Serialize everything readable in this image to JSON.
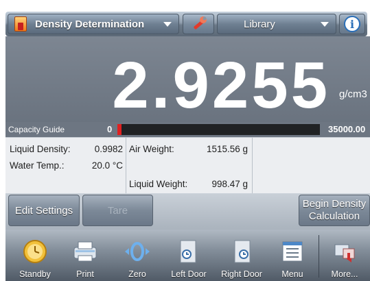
{
  "header": {
    "app_select_label": "Density Determination",
    "library_label": "Library",
    "info_symbol": "i"
  },
  "reading": {
    "value": "2.9255",
    "unit": "g/cm3"
  },
  "capacity_guide": {
    "label": "Capacity Guide",
    "min": "0",
    "max": "35000.00",
    "fill_fraction": 0.02
  },
  "info": {
    "liquid_density_label": "Liquid Density:",
    "liquid_density_value": "0.9982",
    "water_temp_label": "Water Temp.:",
    "water_temp_value": "20.0 °C",
    "air_weight_label": "Air Weight:",
    "air_weight_value": "1515.56 g",
    "liquid_weight_label": "Liquid Weight:",
    "liquid_weight_value": "998.47 g"
  },
  "actions": {
    "edit_settings": "Edit Settings",
    "tare": "Tare",
    "begin_line1": "Begin Density",
    "begin_line2": "Calculation"
  },
  "toolbar": {
    "standby": "Standby",
    "print": "Print",
    "zero": "Zero",
    "left_door": "Left Door",
    "right_door": "Right Door",
    "menu": "Menu",
    "more": "More..."
  },
  "icons": {
    "app": "density-app-icon",
    "wrench": "wrench-icon",
    "info": "info-icon",
    "standby": "standby-clock-icon",
    "print": "printer-icon",
    "zero": "zero-icon",
    "left_door": "left-door-icon",
    "right_door": "right-door-icon",
    "menu": "menu-list-icon",
    "more": "more-tools-icon"
  },
  "colors": {
    "capacity_fill": "#e02020",
    "reading_bg": "#737c88",
    "info_accent": "#2b6fb8"
  }
}
